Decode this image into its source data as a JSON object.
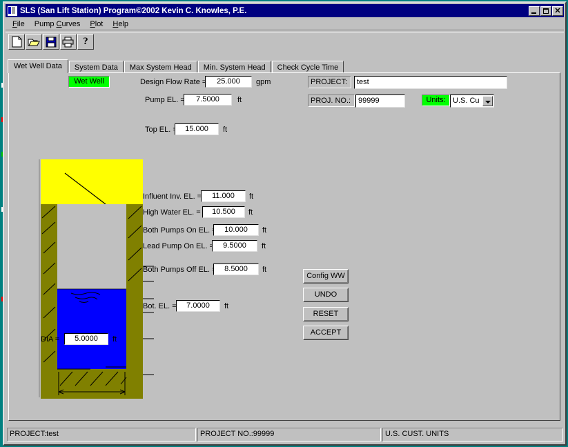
{
  "window": {
    "title": "SLS (San Lift Station) Program©2002 Kevin C. Knowles, P.E.",
    "icon": "app-icon",
    "minimize_label": "",
    "maximize_label": "",
    "close_label": "✕"
  },
  "menu": {
    "items": [
      {
        "label": "File",
        "accel": "F"
      },
      {
        "label": "Pump Curves",
        "accel": "C"
      },
      {
        "label": "Plot",
        "accel": "P"
      },
      {
        "label": "Help",
        "accel": "H"
      }
    ]
  },
  "toolbar": {
    "buttons": [
      {
        "name": "new-file-icon",
        "tooltip": "New"
      },
      {
        "name": "open-folder-icon",
        "tooltip": "Open"
      },
      {
        "name": "save-disk-icon",
        "tooltip": "Save"
      },
      {
        "name": "print-icon",
        "tooltip": "Print"
      },
      {
        "name": "help-question-icon",
        "tooltip": "Help",
        "glyph": "?"
      }
    ]
  },
  "tabs": [
    {
      "label": "Wet Well Data",
      "active": true
    },
    {
      "label": "System Data",
      "active": false
    },
    {
      "label": "Max System Head",
      "active": false
    },
    {
      "label": "Min. System Head",
      "active": false
    },
    {
      "label": "Check Cycle Time",
      "active": false
    }
  ],
  "diagram": {
    "title": "Wet Well",
    "colors": {
      "slab": "#ffff00",
      "wall": "#808000",
      "water": "#0000ff",
      "air": "#c0c0c0",
      "line": "#000000"
    }
  },
  "form": {
    "design_flow_rate": {
      "label": "Design Flow Rate =",
      "value": "25.000",
      "unit": "gpm"
    },
    "pump_el": {
      "label": "Pump EL.  =",
      "value": "7.5000",
      "unit": "ft"
    },
    "top_el": {
      "label": "Top EL. =",
      "value": "15.000",
      "unit": "ft"
    },
    "influent_inv_el": {
      "label": "Influent Inv. EL. =",
      "value": "11.000",
      "unit": "ft"
    },
    "high_water_el": {
      "label": "High Water EL. =",
      "value": "10.500",
      "unit": "ft"
    },
    "both_pumps_on_el": {
      "label": "Both Pumps On EL. =",
      "value": "10.000",
      "unit": "ft"
    },
    "lead_pump_on_el": {
      "label": "Lead Pump On EL. =",
      "value": "9.5000",
      "unit": "ft"
    },
    "both_pumps_off_el": {
      "label": "Both Pumps Off EL. =",
      "value": "8.5000",
      "unit": "ft"
    },
    "bot_el": {
      "label": "Bot. EL. =",
      "value": "7.0000",
      "unit": "ft"
    },
    "dia": {
      "label": "DIA =",
      "value": "5.0000",
      "unit": "ft"
    }
  },
  "project": {
    "project_label": "PROJECT:",
    "project_value": "test",
    "projno_label": "PROJ. NO.:",
    "projno_value": "99999",
    "units_label": "Units:",
    "units_value": "U.S. Cu"
  },
  "actions": {
    "config_ww": "Config WW",
    "undo": "UNDO",
    "reset": "RESET",
    "accept": "ACCEPT"
  },
  "status": {
    "project": "PROJECT:test",
    "project_no": "PROJECT NO.:99999",
    "units": "U.S. CUST. UNITS"
  }
}
